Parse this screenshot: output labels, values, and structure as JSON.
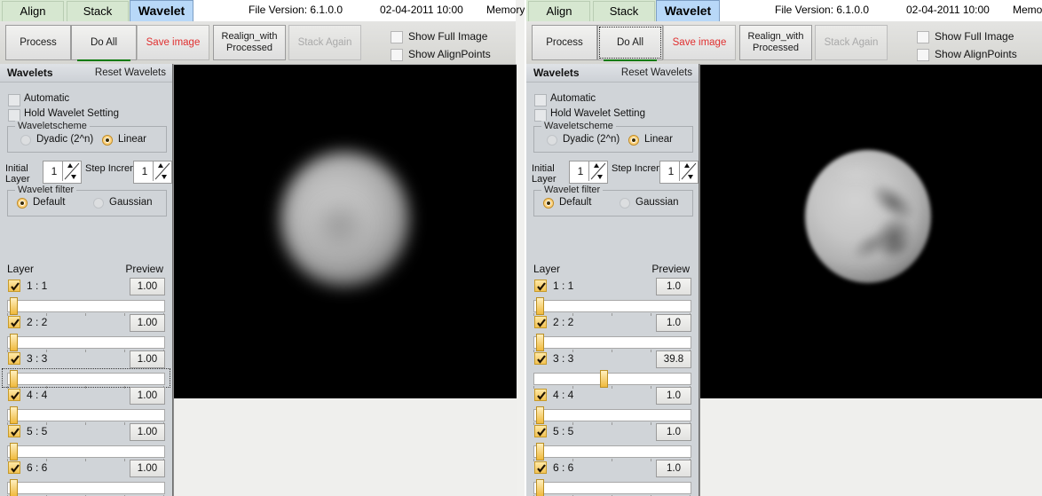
{
  "panes": [
    {
      "id": "before",
      "tabs": [
        {
          "key": "align",
          "label": "Align"
        },
        {
          "key": "stack",
          "label": "Stack"
        },
        {
          "key": "wavelet",
          "label": "Wavelet"
        }
      ],
      "status": {
        "file_version": "File Version: 6.1.0.0",
        "datetime": "02-04-2011 10:00",
        "memory": "Memory Us"
      },
      "toolbar": {
        "process_label": "Process",
        "do_all_label": "Do All",
        "save_image_label": "Save image",
        "realign_line1": "Realign_with",
        "realign_line2": "Processed",
        "stack_again_label": "Stack Again",
        "show_full_image_label": "Show Full Image",
        "show_align_points_label": "Show AlignPoints",
        "do_all_focused": false,
        "save_image_color": "#e03030",
        "do_all_underline_color": "#0a7a0a"
      },
      "sidebar": {
        "title": "Wavelets",
        "reset_label": "Reset Wavelets",
        "automatic_label": "Automatic",
        "hold_label": "Hold Wavelet Setting",
        "scheme_group_label": "Waveletscheme",
        "scheme_dyadic_label": "Dyadic (2^n)",
        "scheme_linear_label": "Linear",
        "initial_layer_l1": "Initial",
        "initial_layer_l2": "Layer",
        "initial_layer_value": "1",
        "step_increment_l1": "Step",
        "step_increment_l2": "Increment",
        "step_increment_value": "1",
        "filter_group_label": "Wavelet filter",
        "filter_default_label": "Default",
        "filter_gaussian_label": "Gaussian",
        "layer_col_label": "Layer",
        "preview_col_label": "Preview"
      },
      "layers": [
        {
          "name": "1 : 1",
          "value": "1.00",
          "slider_pct": 2,
          "checked": true,
          "focused": false
        },
        {
          "name": "2 : 2",
          "value": "1.00",
          "slider_pct": 2,
          "checked": true,
          "focused": false
        },
        {
          "name": "3 : 3",
          "value": "1.00",
          "slider_pct": 2,
          "checked": true,
          "focused": true
        },
        {
          "name": "4 : 4",
          "value": "1.00",
          "slider_pct": 2,
          "checked": true,
          "focused": false
        },
        {
          "name": "5 : 5",
          "value": "1.00",
          "slider_pct": 2,
          "checked": true,
          "focused": false
        },
        {
          "name": "6 : 6",
          "value": "1.00",
          "slider_pct": 2,
          "checked": true,
          "focused": false
        }
      ],
      "image": {
        "description": "blurred planetary disc on black background",
        "sharpened": false
      }
    },
    {
      "id": "after",
      "tabs": [
        {
          "key": "align",
          "label": "Align"
        },
        {
          "key": "stack",
          "label": "Stack"
        },
        {
          "key": "wavelet",
          "label": "Wavelet"
        }
      ],
      "status": {
        "file_version": "File Version: 6.1.0.0",
        "datetime": "02-04-2011 10:00",
        "memory": "Memory"
      },
      "toolbar": {
        "process_label": "Process",
        "do_all_label": "Do All",
        "save_image_label": "Save image",
        "realign_line1": "Realign_with",
        "realign_line2": "Processed",
        "stack_again_label": "Stack Again",
        "show_full_image_label": "Show Full Image",
        "show_align_points_label": "Show AlignPoints",
        "do_all_focused": true,
        "save_image_color": "#e03030",
        "do_all_underline_color": "#0a7a0a"
      },
      "sidebar": {
        "title": "Wavelets",
        "reset_label": "Reset Wavelets",
        "automatic_label": "Automatic",
        "hold_label": "Hold Wavelet Setting",
        "scheme_group_label": "Waveletscheme",
        "scheme_dyadic_label": "Dyadic (2^n)",
        "scheme_linear_label": "Linear",
        "initial_layer_l1": "Initial",
        "initial_layer_l2": "Layer",
        "initial_layer_value": "1",
        "step_increment_l1": "Step",
        "step_increment_l2": "Increment",
        "step_increment_value": "1",
        "filter_group_label": "Wavelet filter",
        "filter_default_label": "Default",
        "filter_gaussian_label": "Gaussian",
        "layer_col_label": "Layer",
        "preview_col_label": "Preview"
      },
      "layers": [
        {
          "name": "1 : 1",
          "value": "1.0",
          "slider_pct": 2,
          "checked": true,
          "focused": false
        },
        {
          "name": "2 : 2",
          "value": "1.0",
          "slider_pct": 2,
          "checked": true,
          "focused": false
        },
        {
          "name": "3 : 3",
          "value": "39.8",
          "slider_pct": 45,
          "checked": true,
          "focused": false
        },
        {
          "name": "4 : 4",
          "value": "1.0",
          "slider_pct": 2,
          "checked": true,
          "focused": false
        },
        {
          "name": "5 : 5",
          "value": "1.0",
          "slider_pct": 2,
          "checked": true,
          "focused": false
        },
        {
          "name": "6 : 6",
          "value": "1.0",
          "slider_pct": 2,
          "checked": true,
          "focused": false
        }
      ],
      "image": {
        "description": "wavelet-sharpened planetary disc showing surface markings",
        "sharpened": true
      }
    }
  ],
  "colors": {
    "tab_active": "#b8d8f8",
    "tab_inactive": "#d6e7d0",
    "sidebar_bg": "#d0d4d8",
    "slider_thumb": "#f0b93c",
    "checkbox_checked": "#f2c252",
    "save_text": "#e03030",
    "do_all_underline": "#0a7a0a"
  }
}
